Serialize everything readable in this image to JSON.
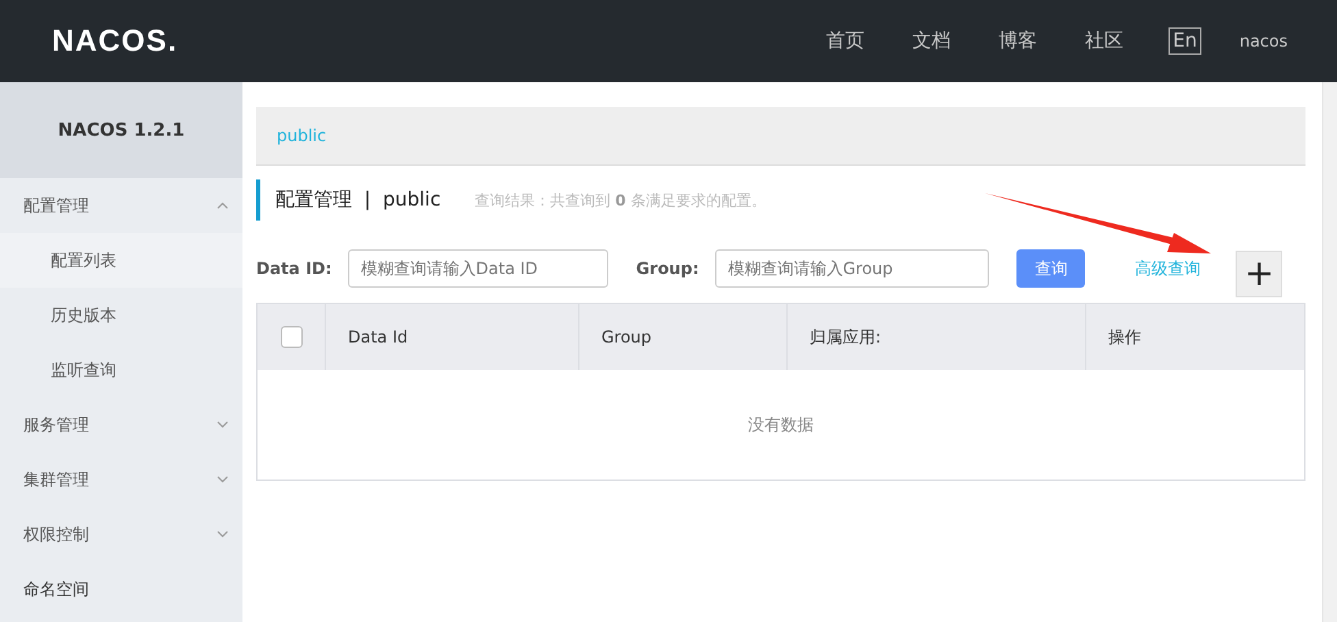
{
  "header": {
    "logo": "NACOS.",
    "nav": [
      {
        "label": "首页"
      },
      {
        "label": "文档"
      },
      {
        "label": "博客"
      },
      {
        "label": "社区"
      }
    ],
    "language": "En",
    "user": "nacos"
  },
  "sidebar": {
    "title": "NACOS 1.2.1",
    "items": [
      {
        "kind": "group",
        "label": "配置管理",
        "expanded": true,
        "children": [
          {
            "label": "配置列表",
            "selected": true
          },
          {
            "label": "历史版本",
            "selected": false
          },
          {
            "label": "监听查询",
            "selected": false
          }
        ]
      },
      {
        "kind": "group",
        "label": "服务管理",
        "expanded": false
      },
      {
        "kind": "group",
        "label": "集群管理",
        "expanded": false
      },
      {
        "kind": "group",
        "label": "权限控制",
        "expanded": false
      },
      {
        "kind": "link",
        "label": "命名空间"
      }
    ]
  },
  "namespace_bar": {
    "namespace": "public"
  },
  "title": {
    "section": "配置管理",
    "separator": "|",
    "namespace": "public",
    "result": "查询结果：共查询到 **0** 条满足要求的配置。"
  },
  "filters": [
    {
      "label": "Data ID:",
      "placeholder": "模糊查询请输入Data ID"
    },
    {
      "label": "Group:",
      "placeholder": "模糊查询请输入Group"
    }
  ],
  "search_button": "查询",
  "advanced_link": "高级查询",
  "add_button": "+",
  "table": {
    "select_all": {
      "checked": false
    },
    "columns": [
      "Data Id",
      "Group",
      "归属应用:",
      "操作"
    ],
    "empty": "没有数据"
  }
}
